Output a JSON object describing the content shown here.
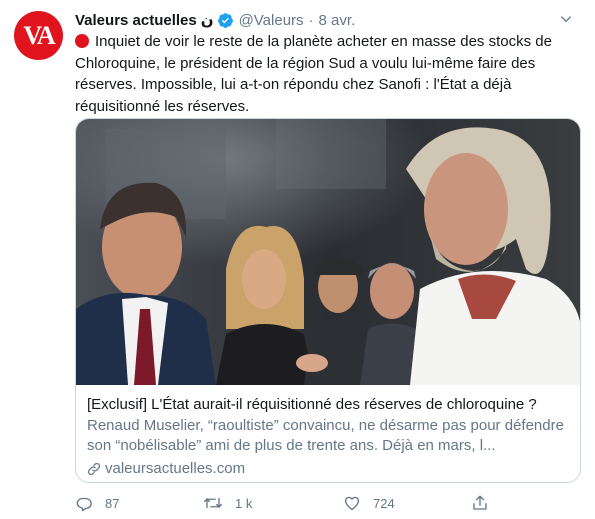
{
  "tweet": {
    "avatar_text": "VA",
    "author_name": "Valeurs actuelles",
    "author_suffix": "ن",
    "handle": "@Valeurs",
    "separator": "·",
    "date": "8 avr.",
    "text": "Inquiet de voir le reste de la planète acheter en masse des stocks de Chloroquine, le président de la région Sud a voulu lui-même faire des réserves. Impossible, lui a-t-on répondu chez Sanofi : l'État a déjà réquisitionné les réserves."
  },
  "card": {
    "title": "[Exclusif] L'État aurait-il réquisitionné des réserves de chloroquine ?",
    "description": "Renaud Muselier, “raoultiste” convaincu, ne désarme pas pour défendre son “nobélisable” ami de plus de trente ans. Déjà en mars, l...",
    "domain": "valeursactuelles.com"
  },
  "actions": {
    "replies": "87",
    "retweets": "1 k",
    "likes": "724"
  },
  "colors": {
    "brand_red": "#e0141d",
    "verified_blue": "#1da1f2",
    "secondary_text": "#657786",
    "border": "#ccd6dd"
  },
  "icons": {
    "verified": "verified-badge-icon",
    "more": "chevron-down-icon",
    "reply": "reply-icon",
    "retweet": "retweet-icon",
    "like": "heart-icon",
    "share": "share-icon",
    "link": "link-icon"
  }
}
